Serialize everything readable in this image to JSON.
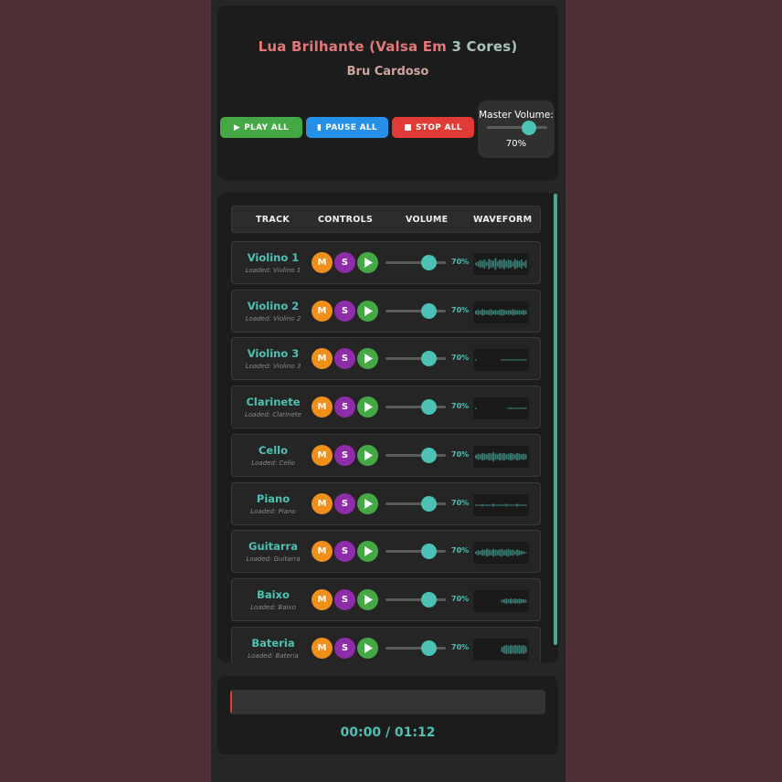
{
  "header": {
    "title_part1": "Lua Brilhante (Valsa Em",
    "title_part2": "3 Cores)",
    "artist": "Bru Cardoso"
  },
  "transport": {
    "play_label": "PLAY ALL",
    "pause_label": "PAUSE ALL",
    "stop_label": "STOP ALL"
  },
  "master": {
    "label": "Master Volume:",
    "value_text": "70%",
    "value": 0.7
  },
  "columns": [
    "TRACK",
    "CONTROLS",
    "VOLUME",
    "WAVEFORM"
  ],
  "controls": {
    "mute": "M",
    "solo": "S"
  },
  "tracks": [
    {
      "name": "Violino 1",
      "status": "Loaded: Violino 1",
      "volume": 0.7,
      "volume_text": "70%",
      "wave": [
        2,
        4,
        6,
        5,
        7,
        3,
        8,
        6,
        5,
        9,
        4,
        7,
        6,
        8,
        5,
        7,
        6,
        4,
        8,
        6,
        5,
        7,
        3,
        6
      ]
    },
    {
      "name": "Violino 2",
      "status": "Loaded: Violino 2",
      "volume": 0.7,
      "volume_text": "70%",
      "wave": [
        3,
        4,
        3,
        5,
        4,
        3,
        4,
        5,
        3,
        4,
        3,
        4,
        5,
        4,
        3,
        4,
        3,
        5,
        4,
        3,
        4,
        3,
        4,
        3
      ]
    },
    {
      "name": "Violino 3",
      "status": "Loaded: Violino 3",
      "volume": 0.7,
      "volume_text": "70%",
      "wave": [
        1,
        0,
        0,
        0,
        0,
        0,
        0,
        0,
        0,
        0,
        0,
        0,
        1,
        1,
        1,
        1,
        1,
        1,
        1,
        1,
        1,
        1,
        1,
        1
      ]
    },
    {
      "name": "Clarinete",
      "status": "Loaded: Clarinete",
      "volume": 0.7,
      "volume_text": "70%",
      "wave": [
        1,
        0,
        0,
        0,
        0,
        0,
        0,
        0,
        0,
        0,
        0,
        0,
        0,
        0,
        0,
        1,
        1,
        1,
        1,
        1,
        1,
        1,
        1,
        1
      ]
    },
    {
      "name": "Cello",
      "status": "Loaded: Cello",
      "volume": 0.7,
      "volume_text": "70%",
      "wave": [
        3,
        5,
        4,
        6,
        5,
        4,
        6,
        5,
        7,
        5,
        4,
        6,
        5,
        6,
        4,
        5,
        6,
        5,
        4,
        6,
        5,
        4,
        5,
        4
      ]
    },
    {
      "name": "Piano",
      "status": "Loaded: Piano",
      "volume": 0.7,
      "volume_text": "70%",
      "wave": [
        1,
        1,
        1,
        2,
        1,
        1,
        1,
        1,
        2,
        1,
        1,
        1,
        1,
        1,
        2,
        1,
        1,
        1,
        1,
        2,
        1,
        1,
        1,
        1
      ]
    },
    {
      "name": "Guitarra",
      "status": "Loaded: Guitarra",
      "volume": 0.7,
      "volume_text": "70%",
      "wave": [
        2,
        4,
        3,
        5,
        4,
        6,
        5,
        4,
        6,
        5,
        4,
        5,
        6,
        4,
        5,
        6,
        4,
        5,
        3,
        5,
        4,
        3,
        2,
        1
      ]
    },
    {
      "name": "Baixo",
      "status": "Loaded: Baixo",
      "volume": 0.7,
      "volume_text": "70%",
      "wave": [
        0,
        0,
        0,
        0,
        0,
        0,
        0,
        0,
        0,
        0,
        0,
        0,
        2,
        3,
        4,
        3,
        4,
        3,
        4,
        3,
        4,
        3,
        3,
        2
      ]
    },
    {
      "name": "Bateria",
      "status": "Loaded: Bateria",
      "volume": 0.7,
      "volume_text": "70%",
      "wave": [
        0,
        0,
        0,
        0,
        0,
        0,
        0,
        0,
        0,
        0,
        0,
        0,
        4,
        6,
        7,
        6,
        7,
        6,
        7,
        6,
        7,
        6,
        7,
        5
      ]
    }
  ],
  "playback": {
    "progress": 0.005,
    "time_text": "00:00 / 01:12"
  },
  "colors": {
    "accent": "#4dc2b4",
    "mute": "#f0901a",
    "solo": "#8e2caa",
    "play": "#44a845",
    "pause": "#2590e8",
    "stop": "#e03b36"
  }
}
